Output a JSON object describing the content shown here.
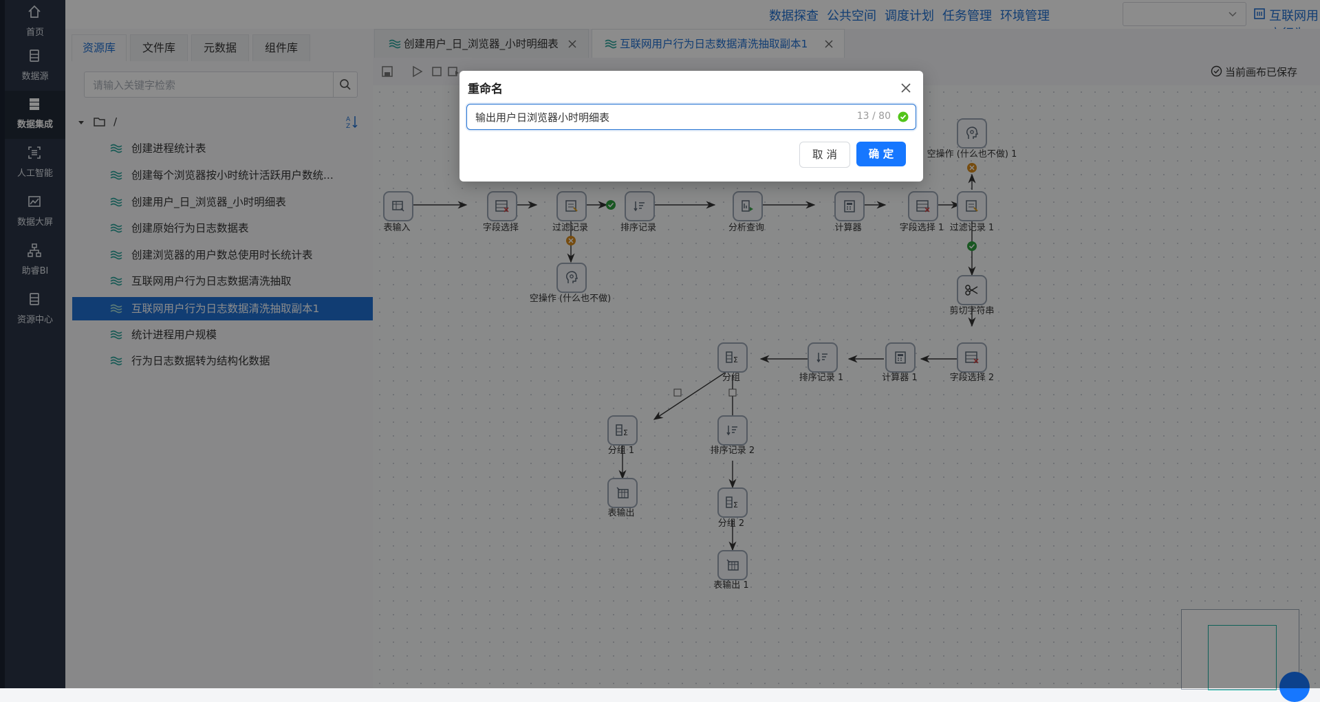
{
  "nav": {
    "items": [
      {
        "label": "首页",
        "icon": "home-icon"
      },
      {
        "label": "数据源",
        "icon": "database-icon"
      },
      {
        "label": "数据集成",
        "icon": "server-icon"
      },
      {
        "label": "人工智能",
        "icon": "ai-icon"
      },
      {
        "label": "数据大屏",
        "icon": "chart-icon"
      },
      {
        "label": "助睿BI",
        "icon": "org-chart-icon"
      },
      {
        "label": "资源中心",
        "icon": "resource-icon"
      }
    ],
    "active": "数据集成"
  },
  "header": {
    "links": [
      "数据探查",
      "公共空间",
      "调度计划",
      "任务管理",
      "环境管理"
    ],
    "env_select_value": "",
    "project_title": "互联网用户行为..."
  },
  "resources": {
    "tabs": [
      "资源库",
      "文件库",
      "元数据",
      "组件库"
    ],
    "active_tab": "资源库",
    "search_placeholder": "请输入关键字检索",
    "root": "/",
    "items": [
      "创建进程统计表",
      "创建每个浏览器按小时统计活跃用户数统...",
      "创建用户_日_浏览器_小时明细表",
      "创建原始行为日志数据表",
      "创建浏览器的用户数总使用时长统计表",
      "互联网用户行为日志数据清洗抽取",
      "互联网用户行为日志数据清洗抽取副本1",
      "统计进程用户规模",
      "行为日志数据转为结构化数据"
    ],
    "active_item": "互联网用户行为日志数据清洗抽取副本1"
  },
  "canvas_tabs": [
    {
      "label": "创建用户_日_浏览器_小时明细表"
    },
    {
      "label": "互联网用户行为日志数据清洗抽取副本1"
    }
  ],
  "toolbar": {
    "saved_status": "当前画布已保存"
  },
  "canvas": {
    "nodes": [
      "表输入",
      "字段选择",
      "过滤记录",
      "排序记录",
      "分析查询",
      "计算器",
      "字段选择 1",
      "过滤记录 1",
      "空操作 (什么也不做) 1",
      "空操作 (什么也不做)",
      "剪切字符串",
      "字段选择 2",
      "计算器 1",
      "排序记录 1",
      "分组",
      "分组 1",
      "排序记录 2",
      "表输出",
      "分组 2",
      "表输出 1"
    ]
  },
  "dialog": {
    "title": "重命名",
    "input_value": "输出用户日浏览器小时明细表",
    "char_count": "13 / 80",
    "cancel_label": "取 消",
    "ok_label": "确 定"
  },
  "colors": {
    "accent": "#1f6fd1",
    "primary_button": "#1677ff",
    "nav_bg": "#2b3445"
  }
}
